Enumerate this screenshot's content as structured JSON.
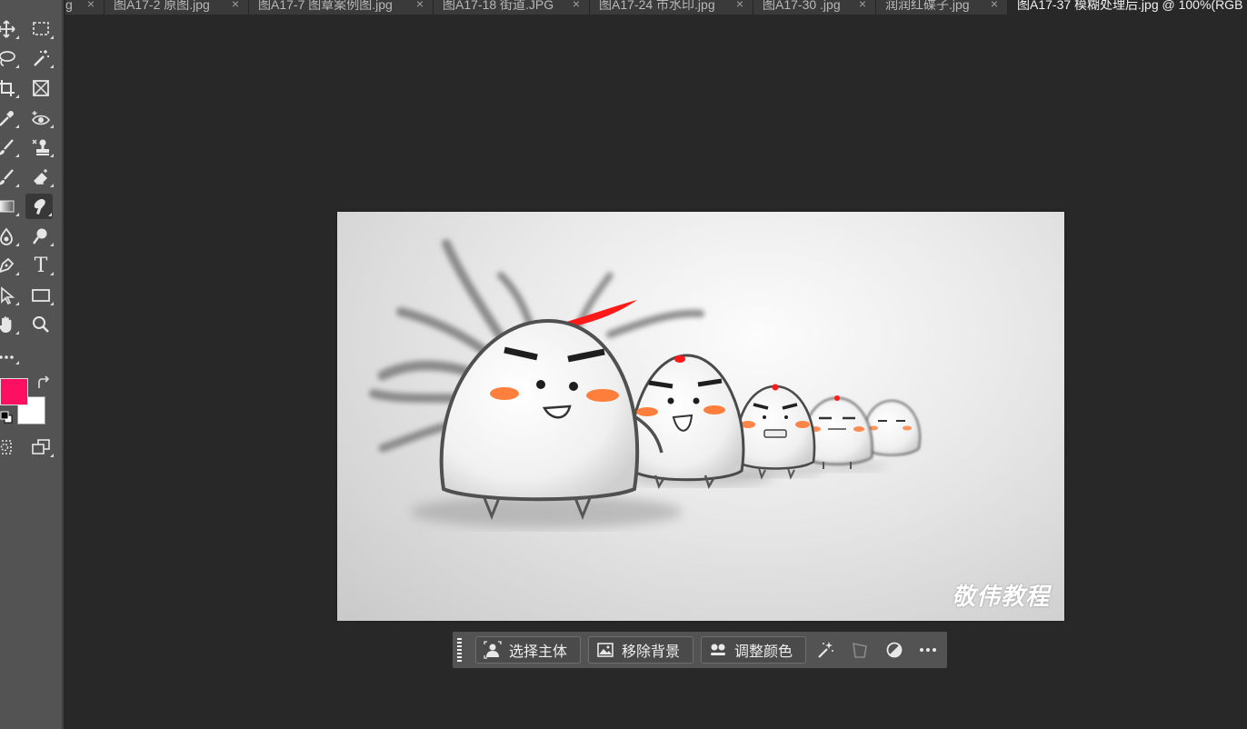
{
  "tabs": [
    {
      "label": "g",
      "close": "×"
    },
    {
      "label": "图A17-2 原图.jpg",
      "close": "×"
    },
    {
      "label": "图A17-7 图章案例图.jpg",
      "close": "×"
    },
    {
      "label": "图A17-18 街道.JPG",
      "close": "×"
    },
    {
      "label": "图A17-24 市水印.jpg",
      "close": "×"
    },
    {
      "label": "图A17-30 .jpg",
      "close": "×"
    },
    {
      "label": "润润红碟子.jpg",
      "close": "×"
    },
    {
      "label": "图A17-37 模糊处理后.jpg @ 100%(RGB",
      "close": ""
    }
  ],
  "toolbar": {
    "tools": [
      {
        "name": "move-tool",
        "icon": "move-icon"
      },
      {
        "name": "marquee-tool",
        "icon": "rect-marquee-icon"
      },
      {
        "name": "lasso-tool",
        "icon": "lasso-icon"
      },
      {
        "name": "magic-wand-tool",
        "icon": "magic-wand-icon"
      },
      {
        "name": "crop-tool",
        "icon": "crop-icon"
      },
      {
        "name": "frame-tool",
        "icon": "frame-icon"
      },
      {
        "name": "eyedropper-tool",
        "icon": "eyedropper-icon"
      },
      {
        "name": "red-eye-tool",
        "icon": "red-eye-icon"
      },
      {
        "name": "brush-tool",
        "icon": "brush-icon"
      },
      {
        "name": "clone-stamp-tool",
        "icon": "stamp-icon"
      },
      {
        "name": "history-brush-tool",
        "icon": "history-brush-icon"
      },
      {
        "name": "eraser-tool",
        "icon": "eraser-icon"
      },
      {
        "name": "gradient-tool",
        "icon": "gradient-icon"
      },
      {
        "name": "smudge-tool",
        "icon": "smudge-icon"
      },
      {
        "name": "dodge-burn-tool",
        "icon": "burn-icon"
      },
      {
        "name": "zoom-dodge-tool",
        "icon": "dodge-icon"
      },
      {
        "name": "pen-tool",
        "icon": "pen-icon"
      },
      {
        "name": "type-tool",
        "icon": "type-icon"
      },
      {
        "name": "path-select-tool",
        "icon": "arrow-icon"
      },
      {
        "name": "rectangle-tool",
        "icon": "rectangle-icon"
      },
      {
        "name": "hand-tool",
        "icon": "hand-icon"
      },
      {
        "name": "zoom-tool",
        "icon": "zoom-icon"
      },
      {
        "name": "more-tools",
        "icon": "more-icon"
      }
    ],
    "type_glyph": "T",
    "foreground_color": "#ff0f62",
    "background_color": "#ffffff"
  },
  "canvas": {
    "watermark": "敬伟教程",
    "accent_red": "#ff1a1a",
    "blush_orange": "#ff6a1a"
  },
  "taskbar": {
    "select_subject": "选择主体",
    "remove_background": "移除背景",
    "adjust_color": "调整颜色",
    "icons": [
      "sparkle-wand-icon",
      "crop-perspective-icon",
      "contrast-icon",
      "more-icon"
    ]
  }
}
